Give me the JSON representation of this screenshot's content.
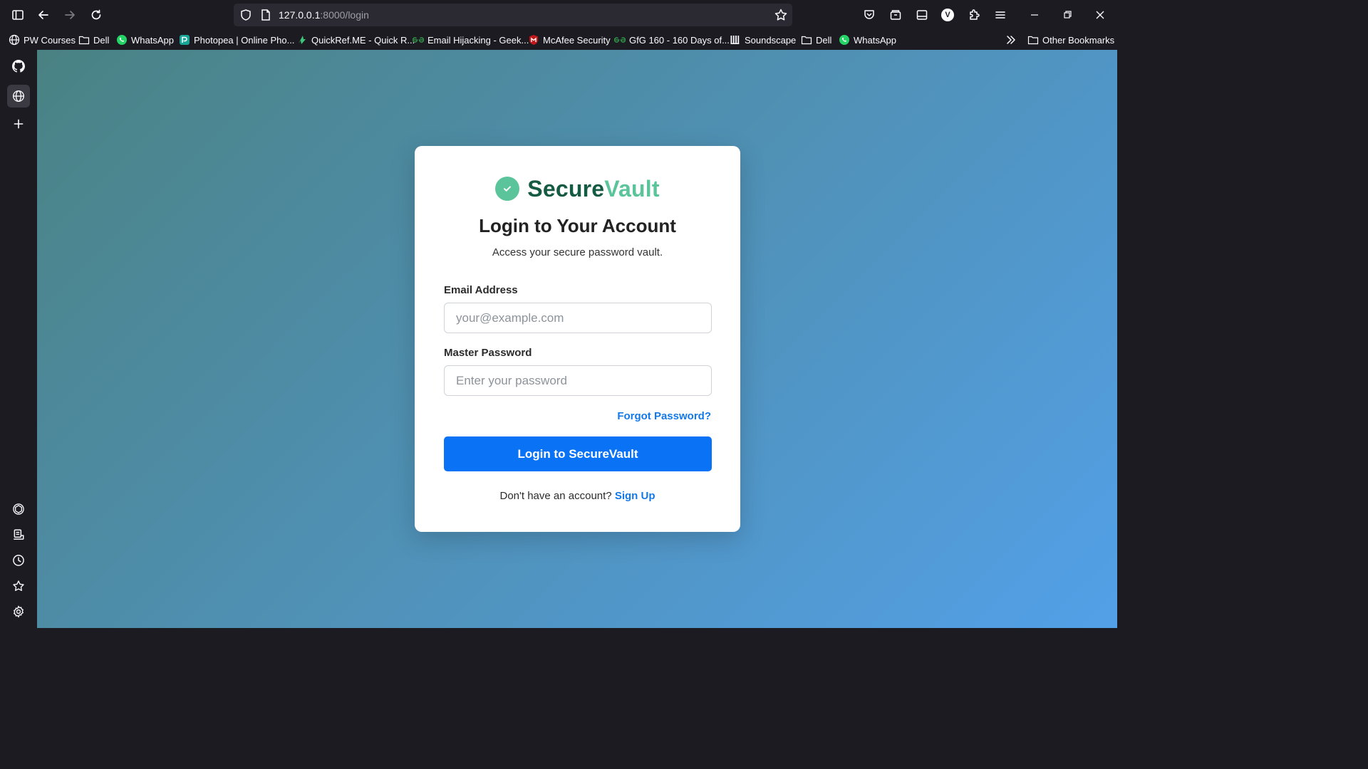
{
  "browser": {
    "url_host": "127.0.0.1",
    "url_path": ":8000/login",
    "toolbar_icons": [
      "sidebar-toggle-icon",
      "back-icon",
      "forward-icon",
      "reload-icon",
      "pocket-icon",
      "container-icon",
      "reader-view-icon",
      "account-icon",
      "extensions-icon",
      "menu-icon",
      "minimize-icon",
      "restore-icon",
      "close-icon"
    ],
    "account_letter": "V"
  },
  "bookmarks": [
    {
      "label": "PW Courses",
      "icon": "globe-icon"
    },
    {
      "label": "Dell",
      "icon": "folder-icon"
    },
    {
      "label": "WhatsApp",
      "icon": "whatsapp-icon"
    },
    {
      "label": "Photopea | Online Pho...",
      "icon": "photopea-icon"
    },
    {
      "label": "QuickRef.ME - Quick R...",
      "icon": "quickref-icon"
    },
    {
      "label": "Email Hijacking - Geek...",
      "icon": "gfg-icon"
    },
    {
      "label": "McAfee Security",
      "icon": "mcafee-icon"
    },
    {
      "label": "GfG 160 - 160 Days of...",
      "icon": "gfg-icon"
    },
    {
      "label": "Soundscape",
      "icon": "soundscape-icon"
    },
    {
      "label": "Dell",
      "icon": "folder-icon"
    },
    {
      "label": "WhatsApp",
      "icon": "whatsapp-icon"
    }
  ],
  "bookmarks_other": "Other Bookmarks",
  "sidebar_icons": [
    "github-icon",
    "globe-icon",
    "plus-icon",
    "chatgpt-icon",
    "bookmark-panel-icon",
    "history-icon",
    "star-icon",
    "settings-icon"
  ],
  "card": {
    "brand_part1": "Secure",
    "brand_part2": "Vault",
    "title": "Login to Your Account",
    "subtitle": "Access your secure password vault.",
    "email_label": "Email Address",
    "email_placeholder": "your@example.com",
    "email_value": "",
    "password_label": "Master Password",
    "password_placeholder": "Enter your password",
    "password_value": "",
    "forgot": "Forgot Password?",
    "login_button": "Login to SecureVault",
    "signup_prompt": "Don't have an account?",
    "signup_link": "Sign Up"
  },
  "colors": {
    "accent_blue": "#0a73f5",
    "brand_dark_green": "#155a43",
    "brand_light_green": "#5cc49b",
    "link_blue": "#1479e8"
  }
}
